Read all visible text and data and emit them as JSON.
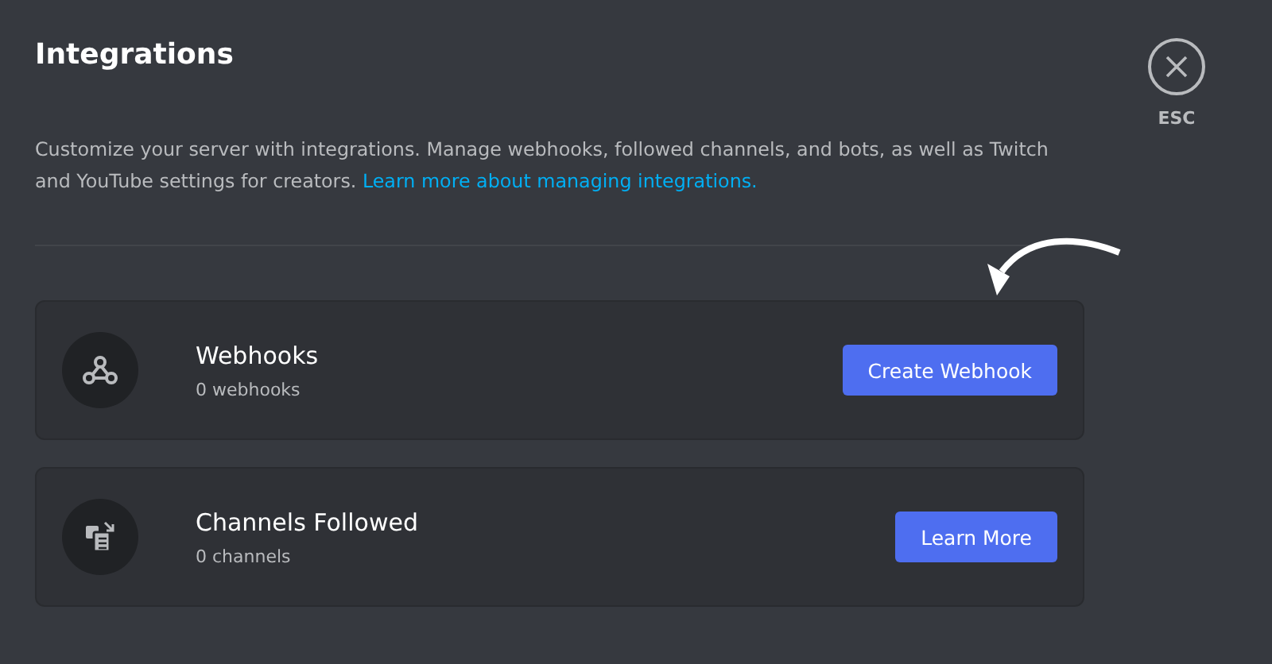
{
  "title": "Integrations",
  "close": {
    "label": "ESC"
  },
  "description": {
    "text": "Customize your server with integrations. Manage webhooks, followed channels, and bots, as well as Twitch and YouTube settings for creators.",
    "link": "Learn more about managing integrations."
  },
  "cards": [
    {
      "kind": "webhooks",
      "title": "Webhooks",
      "subtitle": "0 webhooks",
      "button": "Create Webhook",
      "highlighted": true
    },
    {
      "kind": "channels",
      "title": "Channels Followed",
      "subtitle": "0 channels",
      "button": "Learn More",
      "highlighted": false
    }
  ]
}
